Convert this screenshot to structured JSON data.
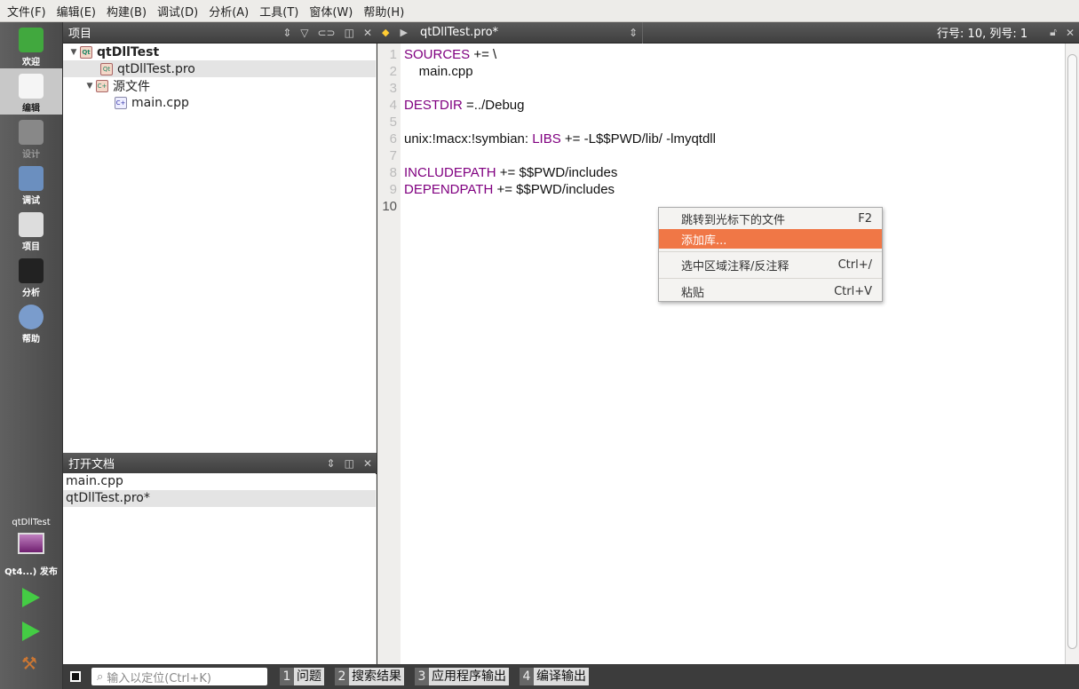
{
  "menu": [
    "文件(F)",
    "编辑(E)",
    "构建(B)",
    "调试(D)",
    "分析(A)",
    "工具(T)",
    "窗体(W)",
    "帮助(H)"
  ],
  "modes": [
    {
      "label": "欢迎",
      "icon": "qt-logo-icon"
    },
    {
      "label": "编辑",
      "icon": "document-edit-icon"
    },
    {
      "label": "设计",
      "icon": "design-icon"
    },
    {
      "label": "调试",
      "icon": "debug-icon"
    },
    {
      "label": "项目",
      "icon": "project-icon"
    },
    {
      "label": "分析",
      "icon": "analyze-icon"
    },
    {
      "label": "帮助",
      "icon": "help-icon"
    }
  ],
  "target": {
    "project": "qtDllTest",
    "kit": "Qt4...) 发布"
  },
  "projects_panel": {
    "title": "项目",
    "tree": [
      {
        "label": "qtDllTest",
        "level": 0
      },
      {
        "label": "qtDllTest.pro",
        "level": 1
      },
      {
        "label": "源文件",
        "level": 1
      },
      {
        "label": "main.cpp",
        "level": 2
      }
    ]
  },
  "open_docs": {
    "title": "打开文档",
    "items": [
      "main.cpp",
      "qtDllTest.pro*"
    ]
  },
  "editor": {
    "file": "qtDllTest.pro*",
    "position": "行号: 10, 列号: 1",
    "lines": [
      {
        "n": "1",
        "kw": "SOURCES",
        "rest": " += \\"
      },
      {
        "n": "2",
        "kw": "",
        "rest": "    main.cpp"
      },
      {
        "n": "3",
        "kw": "",
        "rest": ""
      },
      {
        "n": "4",
        "kw": "DESTDIR",
        "rest": " =../Debug"
      },
      {
        "n": "5",
        "kw": "",
        "rest": ""
      },
      {
        "n": "6",
        "kw": "",
        "rest": "unix:!macx:!symbian: ",
        "kw2": "LIBS",
        "rest2": " += -L$$PWD/lib/ -lmyqtdll"
      },
      {
        "n": "7",
        "kw": "",
        "rest": ""
      },
      {
        "n": "8",
        "kw": "INCLUDEPATH",
        "rest": " += $$PWD/includes"
      },
      {
        "n": "9",
        "kw": "DEPENDPATH",
        "rest": " += $$PWD/includes"
      },
      {
        "n": "10",
        "kw": "",
        "rest": ""
      }
    ]
  },
  "context_menu": [
    {
      "label": "跳转到光标下的文件",
      "shortcut": "F2"
    },
    {
      "label": "添加库...",
      "shortcut": "",
      "highlighted": true
    },
    {
      "label": "选中区域注释/反注释",
      "shortcut": "Ctrl+/"
    },
    {
      "label": "粘贴",
      "shortcut": "Ctrl+V"
    }
  ],
  "bottom": {
    "search_placeholder": "输入以定位(Ctrl+K)",
    "tabs": [
      {
        "n": "1",
        "label": "问题"
      },
      {
        "n": "2",
        "label": "搜索结果"
      },
      {
        "n": "3",
        "label": "应用程序输出"
      },
      {
        "n": "4",
        "label": "编译输出"
      }
    ]
  },
  "colors": {
    "keyword": "#800080",
    "menu_highlight": "#f07746"
  }
}
